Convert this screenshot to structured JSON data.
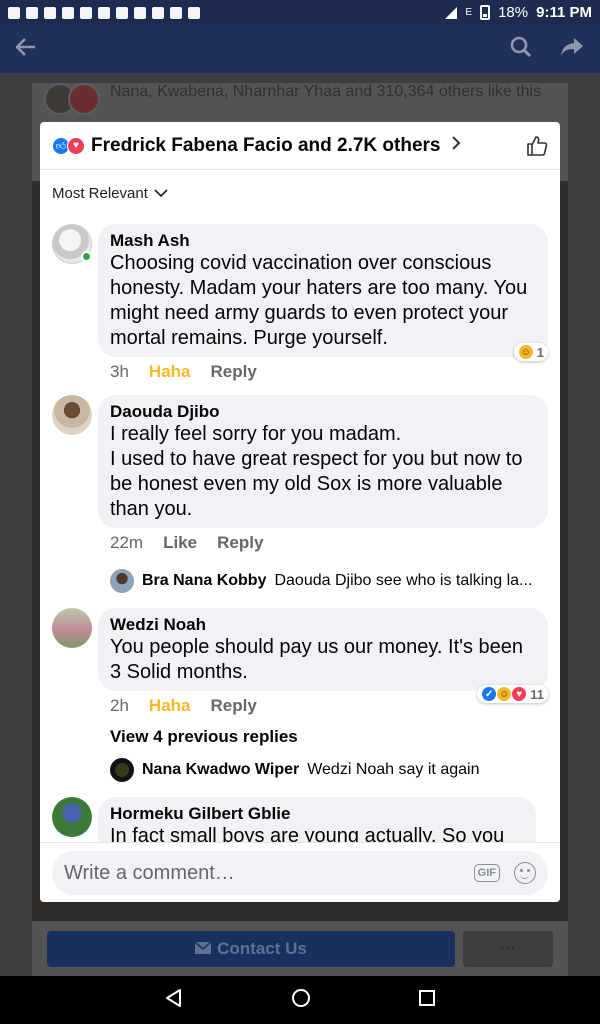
{
  "status_bar": {
    "battery": "18%",
    "time": "9:11 PM",
    "network": "E"
  },
  "header": {
    "back_icon": "arrow-left-icon",
    "search_icon": "search-icon",
    "share_icon": "share-icon"
  },
  "background": {
    "likes_text": "Nana, Kwabena, Nharnhar Yhaa and 310,364 others like this",
    "contact_label": "Contact Us",
    "more_label": "···"
  },
  "modal": {
    "title": "Fredrick Fabena Facio and 2.7K others",
    "sort_label": "Most Relevant",
    "comments": [
      {
        "author": "Mash Ash",
        "text": "Choosing covid vaccination over conscious honesty. Madam your haters are too many. You might need army guards to even protect your mortal remains. Purge yourself.",
        "time": "3h",
        "reaction": "Haha",
        "reply": "Reply",
        "reaction_count": "1"
      },
      {
        "author": "Daouda Djibo",
        "text": "I really feel sorry for you madam.\nI used to have great respect for you  but now to be honest even my old Sox is more valuable than you.",
        "time": "22m",
        "reaction": "Like",
        "reply": "Reply",
        "reply_preview": {
          "author": "Bra Nana Kobby",
          "text": "Daouda Djibo see who is talking la..."
        }
      },
      {
        "author": "Wedzi Noah",
        "text": "You people should pay us our money. It's been 3 Solid months.",
        "time": "2h",
        "reaction": "Haha",
        "reply": "Reply",
        "reaction_count": "11",
        "view_previous": "View 4 previous replies",
        "reply_preview": {
          "author": "Nana Kwadwo Wiper",
          "text": "Wedzi Noah say it again"
        }
      },
      {
        "author": "Hormeku Gilbert Gblie",
        "text": "In fact small boys are young actually. So you"
      }
    ],
    "composer_placeholder": "Write a comment…",
    "gif_label": "GIF"
  },
  "colors": {
    "header_bg": "#20305a",
    "status_bg": "#1c2b4f",
    "haha": "#f7b928",
    "like_blue": "#1877f2",
    "love_red": "#f33e58",
    "online_green": "#31a24c"
  }
}
